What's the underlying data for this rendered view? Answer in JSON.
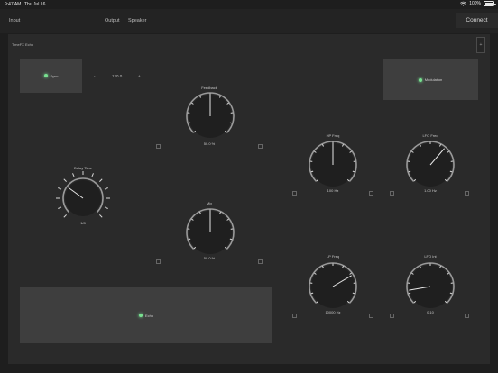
{
  "status_bar": {
    "time": "9:47 AM",
    "date": "Thu Jul 16",
    "battery": "100%"
  },
  "top_bar": {
    "input_label": "Input",
    "output_label": "Output",
    "speaker_label": "Speaker",
    "connect_label": "Connect"
  },
  "panel": {
    "title": "TimeFX Echo",
    "add_symbol": "+"
  },
  "sync": {
    "label": "Sync"
  },
  "tempo": {
    "minus": "-",
    "value": "120.0",
    "plus": "+"
  },
  "modulation": {
    "label": "Modulation"
  },
  "echo": {
    "label": "Echo"
  },
  "knobs": {
    "feedback": {
      "label": "Feedback",
      "value": "50.0 %",
      "level": 0.5
    },
    "delay_time": {
      "label": "Delay Time",
      "value": "1/8",
      "level": 0.3
    },
    "mix": {
      "label": "Mix",
      "value": "50.0 %",
      "level": 0.5
    },
    "hp_freq": {
      "label": "HP Freq",
      "value": "100 Hz",
      "level": 0.5
    },
    "lfo_freq": {
      "label": "LFO Freq",
      "value": "1.00 Hz",
      "level": 0.65
    },
    "lp_freq": {
      "label": "LP Freq",
      "value": "10000 Hz",
      "level": 0.72
    },
    "lfo_int": {
      "label": "LFO Int",
      "value": "0.10",
      "level": 0.13
    }
  },
  "colors": {
    "background": "#1e1e1e",
    "panel": "#2a2a2a",
    "toggle": "#3e3e3e",
    "led": "#78e08f"
  }
}
